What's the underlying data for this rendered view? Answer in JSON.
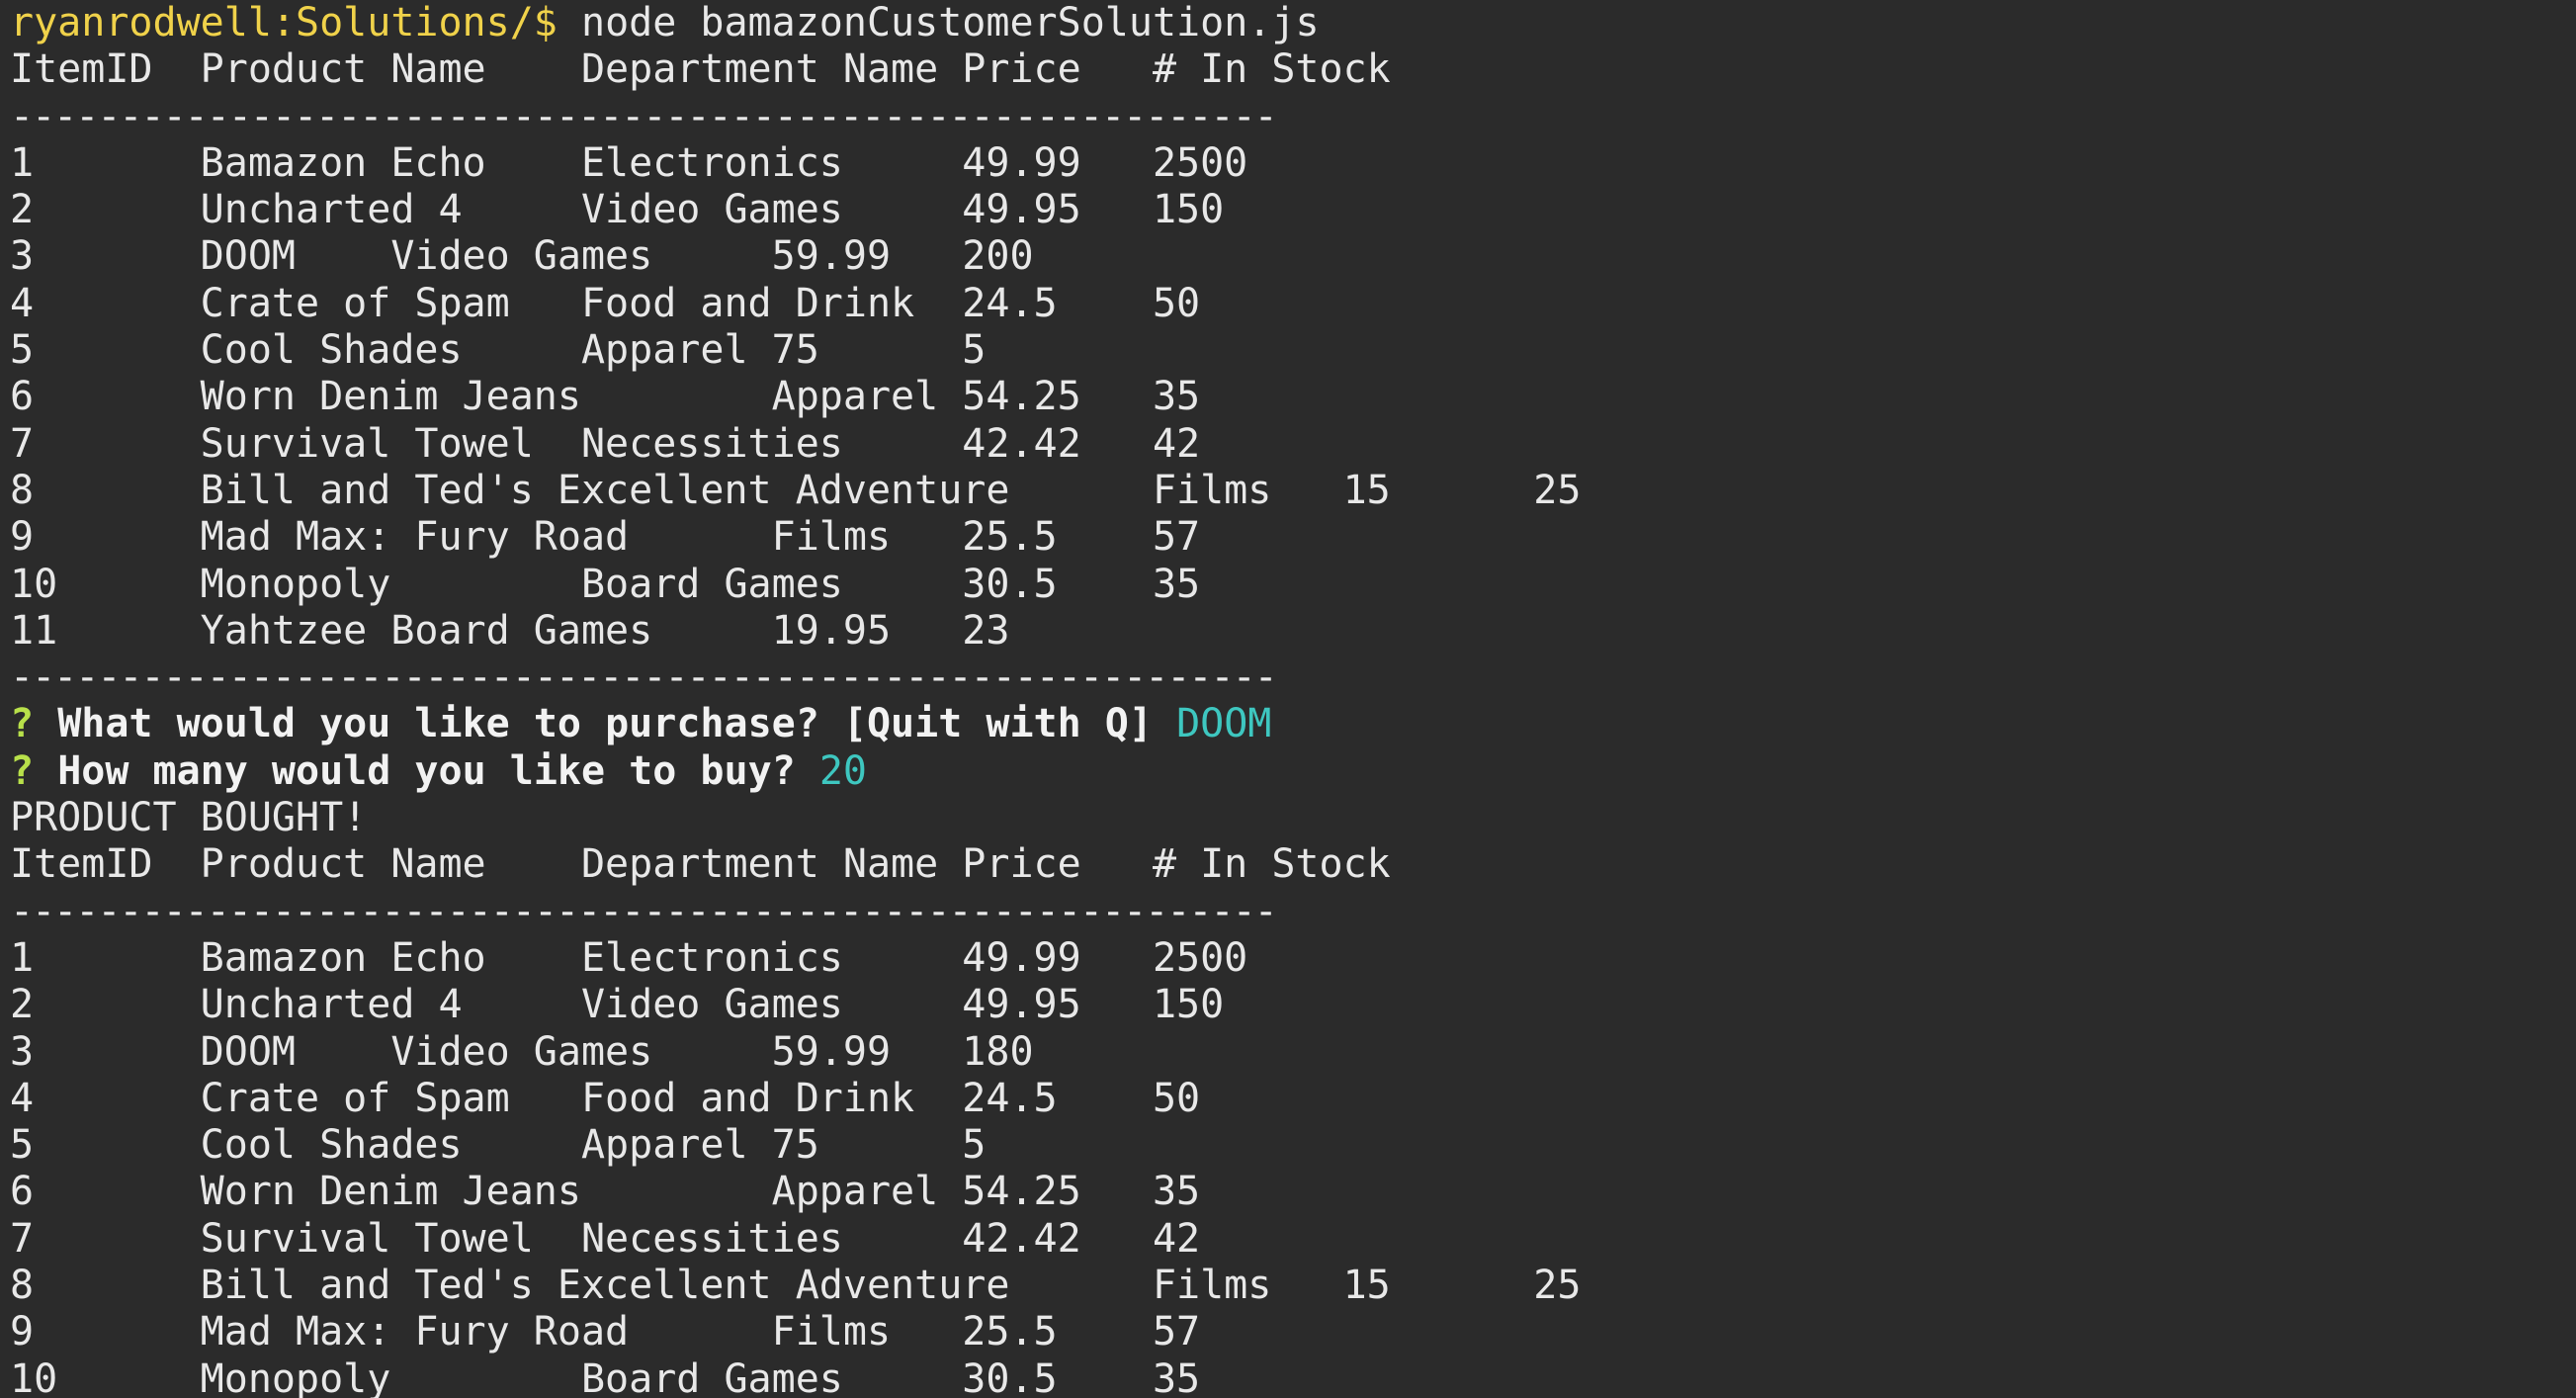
{
  "prompt": {
    "user_dir": "ryanrodwell:Solutions/$",
    "command": "node bamazonCustomerSolution.js"
  },
  "separator": "----------------------------------------------------------",
  "table_header": "ItemID  Product Name    Department Name Price   # In Stock",
  "first_table": [
    "1       Bamazon Echo    Electronics     49.99   2500",
    "2       Uncharted 4     Video Games     49.95   150",
    "3       DOOM    Video Games     59.99   200",
    "4       Crate of Spam   Food and Drink  24.5    50",
    "5       Cool Shades     Apparel 75      5",
    "6       Worn Denim Jeans        Apparel 54.25   35",
    "7       Survival Towel  Necessities     42.42   42",
    "8       Bill and Ted's Excellent Adventure      Films   15      25",
    "9       Mad Max: Fury Road      Films   25.5    57",
    "10      Monopoly        Board Games     30.5    35",
    "11      Yahtzee Board Games     19.95   23"
  ],
  "questions": [
    {
      "mark": "?",
      "text": "What would you like to purchase? [Quit with Q]",
      "answer": "DOOM"
    },
    {
      "mark": "?",
      "text": "How many would you like to buy?",
      "answer": "20"
    }
  ],
  "status_message": "PRODUCT BOUGHT!",
  "second_table": [
    "1       Bamazon Echo    Electronics     49.99   2500",
    "2       Uncharted 4     Video Games     49.95   150",
    "3       DOOM    Video Games     59.99   180",
    "4       Crate of Spam   Food and Drink  24.5    50",
    "5       Cool Shades     Apparel 75      5",
    "6       Worn Denim Jeans        Apparel 54.25   35",
    "7       Survival Towel  Necessities     42.42   42",
    "8       Bill and Ted's Excellent Adventure      Films   15      25",
    "9       Mad Max: Fury Road      Films   25.5    57",
    "10      Monopoly        Board Games     30.5    35"
  ],
  "colors": {
    "background": "#2b2b2b",
    "foreground": "#e8e8e8",
    "prompt": "#f0d24a",
    "question_mark": "#b8e04a",
    "answer": "#3ec7c0"
  }
}
